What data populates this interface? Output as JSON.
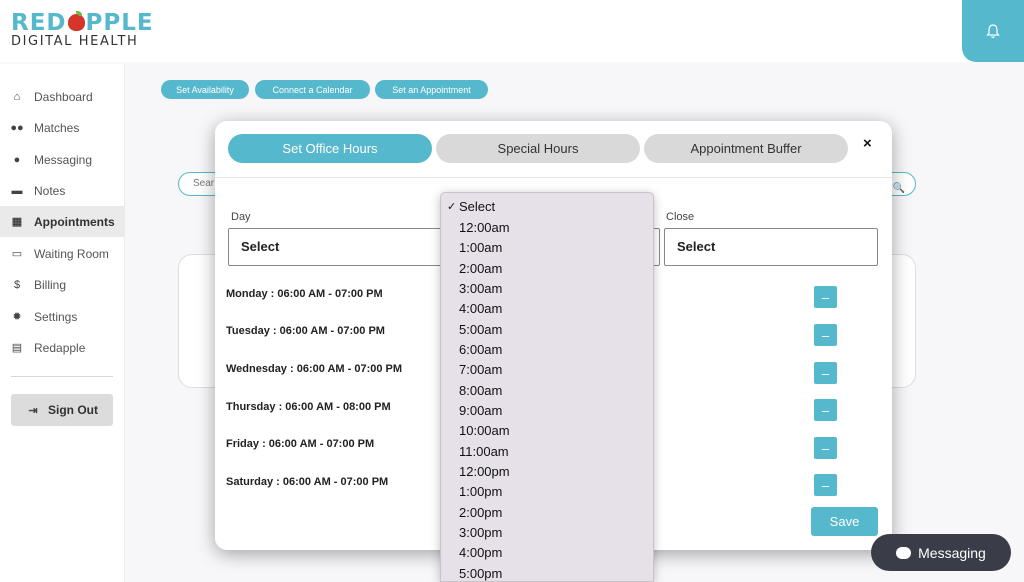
{
  "logo": {
    "top_left": "RED",
    "top_right": "PPLE",
    "bottom": "DIGITAL HEALTH"
  },
  "header": {
    "bell_icon": "bell-icon"
  },
  "sidebar": {
    "items": [
      {
        "label": "Dashboard",
        "icon": "home-icon"
      },
      {
        "label": "Matches",
        "icon": "users-icon"
      },
      {
        "label": "Messaging",
        "icon": "chat-icon"
      },
      {
        "label": "Notes",
        "icon": "scroll-icon"
      },
      {
        "label": "Appointments",
        "icon": "table-icon",
        "active": true
      },
      {
        "label": "Waiting Room",
        "icon": "video-icon"
      },
      {
        "label": "Billing",
        "icon": "dollar-icon"
      },
      {
        "label": "Settings",
        "icon": "gear-icon"
      },
      {
        "label": "Redapple",
        "icon": "document-icon"
      }
    ],
    "signout_label": "Sign Out"
  },
  "actions": {
    "set_availability": "Set Availability",
    "connect_calendar": "Connect a Calendar",
    "set_appointment": "Set an Appointment"
  },
  "background": {
    "search_placeholder": "Sear"
  },
  "modal": {
    "tabs": [
      "Set Office Hours",
      "Special Hours",
      "Appointment Buffer"
    ],
    "close": "×",
    "day_label": "Day",
    "close_label": "Close",
    "day_value": "Select",
    "close_value": "Select",
    "schedule": [
      "Monday : 06:00 AM - 07:00 PM",
      "Tuesday : 06:00 AM - 07:00 PM",
      "Wednesday : 06:00 AM - 07:00 PM",
      "Thursday : 06:00 AM - 08:00 PM",
      "Friday : 06:00 AM - 07:00 PM",
      "Saturday : 06:00 AM - 07:00 PM"
    ],
    "remove_label": "–",
    "save_label": "Save"
  },
  "dropdown": {
    "selected": "Select",
    "options": [
      "Select",
      "12:00am",
      "1:00am",
      "2:00am",
      "3:00am",
      "4:00am",
      "5:00am",
      "6:00am",
      "7:00am",
      "8:00am",
      "9:00am",
      "10:00am",
      "11:00am",
      "12:00pm",
      "1:00pm",
      "2:00pm",
      "3:00pm",
      "4:00pm",
      "5:00pm"
    ]
  },
  "messaging_chip": {
    "label": "Messaging"
  },
  "colors": {
    "accent": "#56b8cc",
    "brand_red": "#d6352b",
    "chip": "#3a3d47"
  }
}
